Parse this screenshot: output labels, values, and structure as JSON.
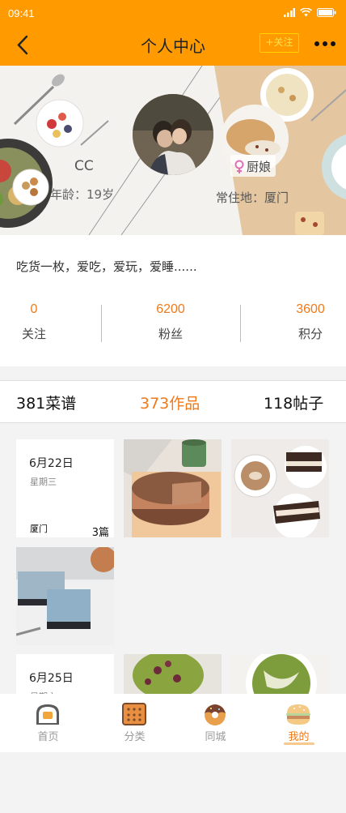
{
  "status_bar": {
    "time": "09:41"
  },
  "nav": {
    "title": "个人中心",
    "follow_label": "+关注"
  },
  "profile": {
    "name": "CC",
    "age": "年龄：19岁",
    "role": "厨娘",
    "location": "常住地：厦门",
    "bio": "吃货一枚，爱吃，爱玩，爱睡......"
  },
  "stats": [
    {
      "value": "0",
      "label": "关注"
    },
    {
      "value": "6200",
      "label": "粉丝"
    },
    {
      "value": "3600",
      "label": "积分"
    }
  ],
  "tabs": [
    {
      "label": "381菜谱",
      "active": false
    },
    {
      "label": "373作品",
      "active": true
    },
    {
      "label": "118帖子",
      "active": false
    }
  ],
  "posts": [
    {
      "date": "6月22日",
      "weekday": "星期三",
      "city": "厦门",
      "count": "3篇"
    },
    {
      "date": "6月25日",
      "weekday": "星期六"
    }
  ],
  "bottom_nav": [
    {
      "label": "首页",
      "icon": "bread-icon",
      "active": false
    },
    {
      "label": "分类",
      "icon": "biscuit-icon",
      "active": false
    },
    {
      "label": "同城",
      "icon": "donut-icon",
      "active": false
    },
    {
      "label": "我的",
      "icon": "burger-icon",
      "active": true
    }
  ],
  "colors": {
    "brand": "#ff9b00",
    "accent": "#f07a1a"
  }
}
